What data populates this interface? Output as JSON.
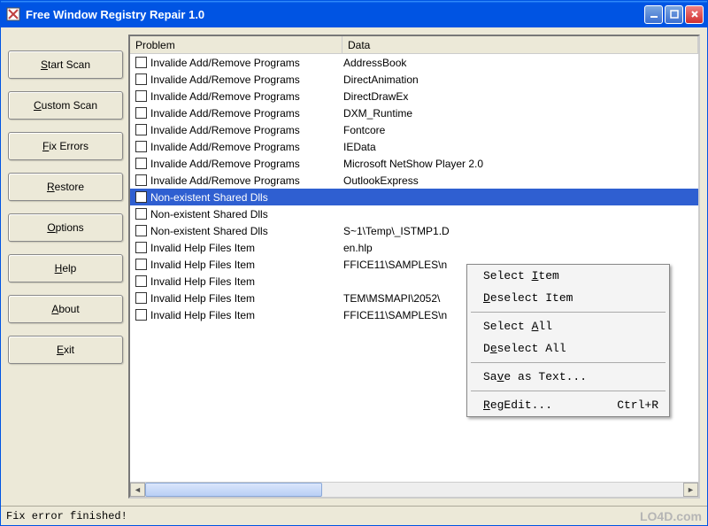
{
  "window": {
    "title": "Free Window Registry Repair 1.0"
  },
  "sidebar": {
    "buttons": [
      {
        "pre": "",
        "mn": "S",
        "post": "tart Scan"
      },
      {
        "pre": "",
        "mn": "C",
        "post": "ustom Scan"
      },
      {
        "pre": "",
        "mn": "F",
        "post": "ix Errors"
      },
      {
        "pre": "",
        "mn": "R",
        "post": "estore"
      },
      {
        "pre": "",
        "mn": "O",
        "post": "ptions"
      },
      {
        "pre": "",
        "mn": "H",
        "post": "elp"
      },
      {
        "pre": "",
        "mn": "A",
        "post": "bout"
      },
      {
        "pre": "",
        "mn": "E",
        "post": "xit"
      }
    ]
  },
  "list": {
    "headers": {
      "problem": "Problem",
      "data": "Data"
    },
    "rows": [
      {
        "problem": "Invalide Add/Remove Programs",
        "data": "AddressBook",
        "selected": false
      },
      {
        "problem": "Invalide Add/Remove Programs",
        "data": "DirectAnimation",
        "selected": false
      },
      {
        "problem": "Invalide Add/Remove Programs",
        "data": "DirectDrawEx",
        "selected": false
      },
      {
        "problem": "Invalide Add/Remove Programs",
        "data": "DXM_Runtime",
        "selected": false
      },
      {
        "problem": "Invalide Add/Remove Programs",
        "data": "Fontcore",
        "selected": false
      },
      {
        "problem": "Invalide Add/Remove Programs",
        "data": "IEData",
        "selected": false
      },
      {
        "problem": "Invalide Add/Remove Programs",
        "data": "Microsoft NetShow Player 2.0",
        "selected": false
      },
      {
        "problem": "Invalide Add/Remove Programs",
        "data": "OutlookExpress",
        "selected": false
      },
      {
        "problem": "Non-existent Shared Dlls",
        "data": "",
        "selected": true
      },
      {
        "problem": "Non-existent Shared Dlls",
        "data": "",
        "selected": false
      },
      {
        "problem": "Non-existent Shared Dlls",
        "data": "S~1\\Temp\\_ISTMP1.D",
        "selected": false
      },
      {
        "problem": "Invalid Help Files Item",
        "data": "en.hlp",
        "selected": false
      },
      {
        "problem": "Invalid Help Files Item",
        "data": "FFICE11\\SAMPLES\\n",
        "selected": false
      },
      {
        "problem": "Invalid Help Files Item",
        "data": "",
        "selected": false
      },
      {
        "problem": "Invalid Help Files Item",
        "data": "TEM\\MSMAPI\\2052\\",
        "selected": false
      },
      {
        "problem": "Invalid Help Files Item",
        "data": "FFICE11\\SAMPLES\\n",
        "selected": false
      }
    ]
  },
  "context_menu": {
    "items": [
      {
        "type": "item",
        "pre": "Select ",
        "mn": "I",
        "post": "tem",
        "accel": ""
      },
      {
        "type": "item",
        "pre": "",
        "mn": "D",
        "post": "eselect Item",
        "accel": ""
      },
      {
        "type": "sep"
      },
      {
        "type": "item",
        "pre": "Select ",
        "mn": "A",
        "post": "ll",
        "accel": ""
      },
      {
        "type": "item",
        "pre": "D",
        "mn": "e",
        "post": "select All",
        "accel": ""
      },
      {
        "type": "sep"
      },
      {
        "type": "item",
        "pre": "Sa",
        "mn": "v",
        "post": "e as Text...",
        "accel": ""
      },
      {
        "type": "sep"
      },
      {
        "type": "item",
        "pre": "",
        "mn": "R",
        "post": "egEdit...",
        "accel": "Ctrl+R"
      }
    ]
  },
  "status": "Fix error finished!",
  "watermark": "LO4D.com"
}
